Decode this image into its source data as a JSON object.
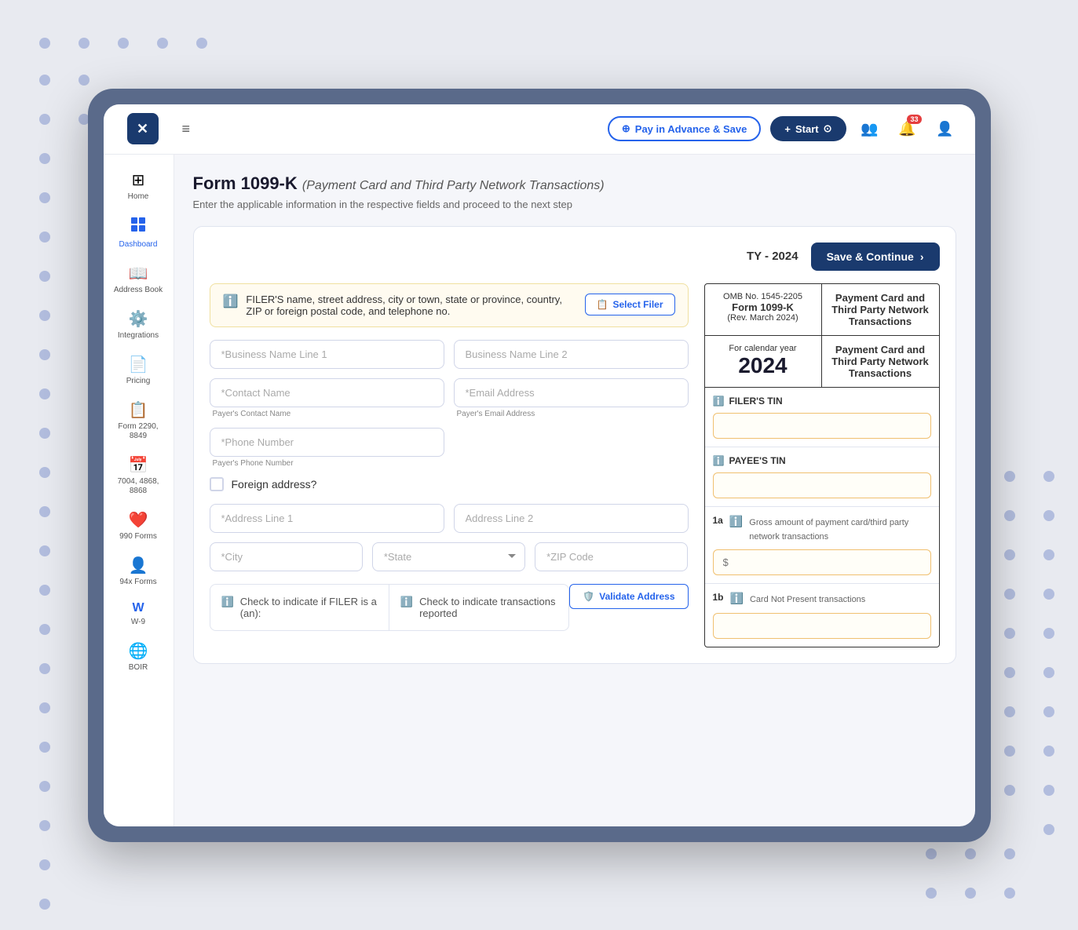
{
  "app": {
    "logo_text": "✕",
    "header": {
      "hamburger": "≡",
      "pay_advance_label": "Pay in Advance & Save",
      "start_label": "Start",
      "notification_count": "33"
    }
  },
  "sidebar": {
    "items": [
      {
        "label": "Home",
        "icon": "⊞",
        "active": false
      },
      {
        "label": "Dashboard",
        "icon": "📊",
        "active": false
      },
      {
        "label": "Address Book",
        "icon": "📖",
        "active": false
      },
      {
        "label": "Integrations",
        "icon": "⚙️",
        "active": false
      },
      {
        "label": "Pricing",
        "icon": "📄",
        "active": false
      },
      {
        "label": "Form 2290, 8849",
        "icon": "📋",
        "active": false
      },
      {
        "label": "7004, 4868, 8868",
        "icon": "📅",
        "active": false
      },
      {
        "label": "990 Forms",
        "icon": "❤️",
        "active": false
      },
      {
        "label": "94x Forms",
        "icon": "👤",
        "active": false
      },
      {
        "label": "W-9",
        "icon": "W",
        "active": false
      },
      {
        "label": "BOIR",
        "icon": "🌐",
        "active": false
      }
    ]
  },
  "page": {
    "title": "Form 1099-K",
    "subtitle": "(Payment Card and Third Party Network Transactions)",
    "description": "Enter the applicable information in the respective fields and proceed to the next step",
    "ty_label": "TY - 2024",
    "save_continue_label": "Save & Continue"
  },
  "filer_section": {
    "info_text": "FILER'S name, street address, city or town, state or province, country, ZIP or foreign postal code, and telephone no.",
    "select_filer_label": "Select Filer"
  },
  "form_fields": {
    "business_name_1_placeholder": "*Business Name Line 1",
    "business_name_2_placeholder": "Business Name Line 2",
    "contact_name_placeholder": "*Contact Name",
    "contact_name_sublabel": "Payer's Contact Name",
    "email_placeholder": "*Email Address",
    "email_sublabel": "Payer's Email Address",
    "phone_placeholder": "*Phone Number",
    "phone_sublabel": "Payer's Phone Number",
    "foreign_address_label": "Foreign address?",
    "address_line1_placeholder": "*Address Line 1",
    "address_line2_placeholder": "Address Line 2",
    "city_placeholder": "*City",
    "state_placeholder": "*State",
    "zip_placeholder": "*ZIP Code",
    "validate_label": "Validate Address"
  },
  "check_sections": {
    "filer_check_label": "Check to indicate if FILER is a (an):",
    "transactions_check_label": "Check to indicate transactions reported"
  },
  "omb_panel": {
    "omb_number": "OMB No. 1545-2205",
    "form_number": "Form 1099-K",
    "revision": "(Rev. March 2024)",
    "right_header": "Payment Card and Third Party Network Transactions",
    "calendar_label": "For calendar year",
    "calendar_year": "2024",
    "filer_tin_label": "FILER'S TIN",
    "payee_tin_label": "PAYEE'S TIN",
    "field_1a_num": "1a",
    "field_1a_label": "Gross amount of payment card/third party network transactions",
    "amount_prefix": "$",
    "field_1b_num": "1b",
    "field_1b_label": "Card Not Present transactions"
  }
}
